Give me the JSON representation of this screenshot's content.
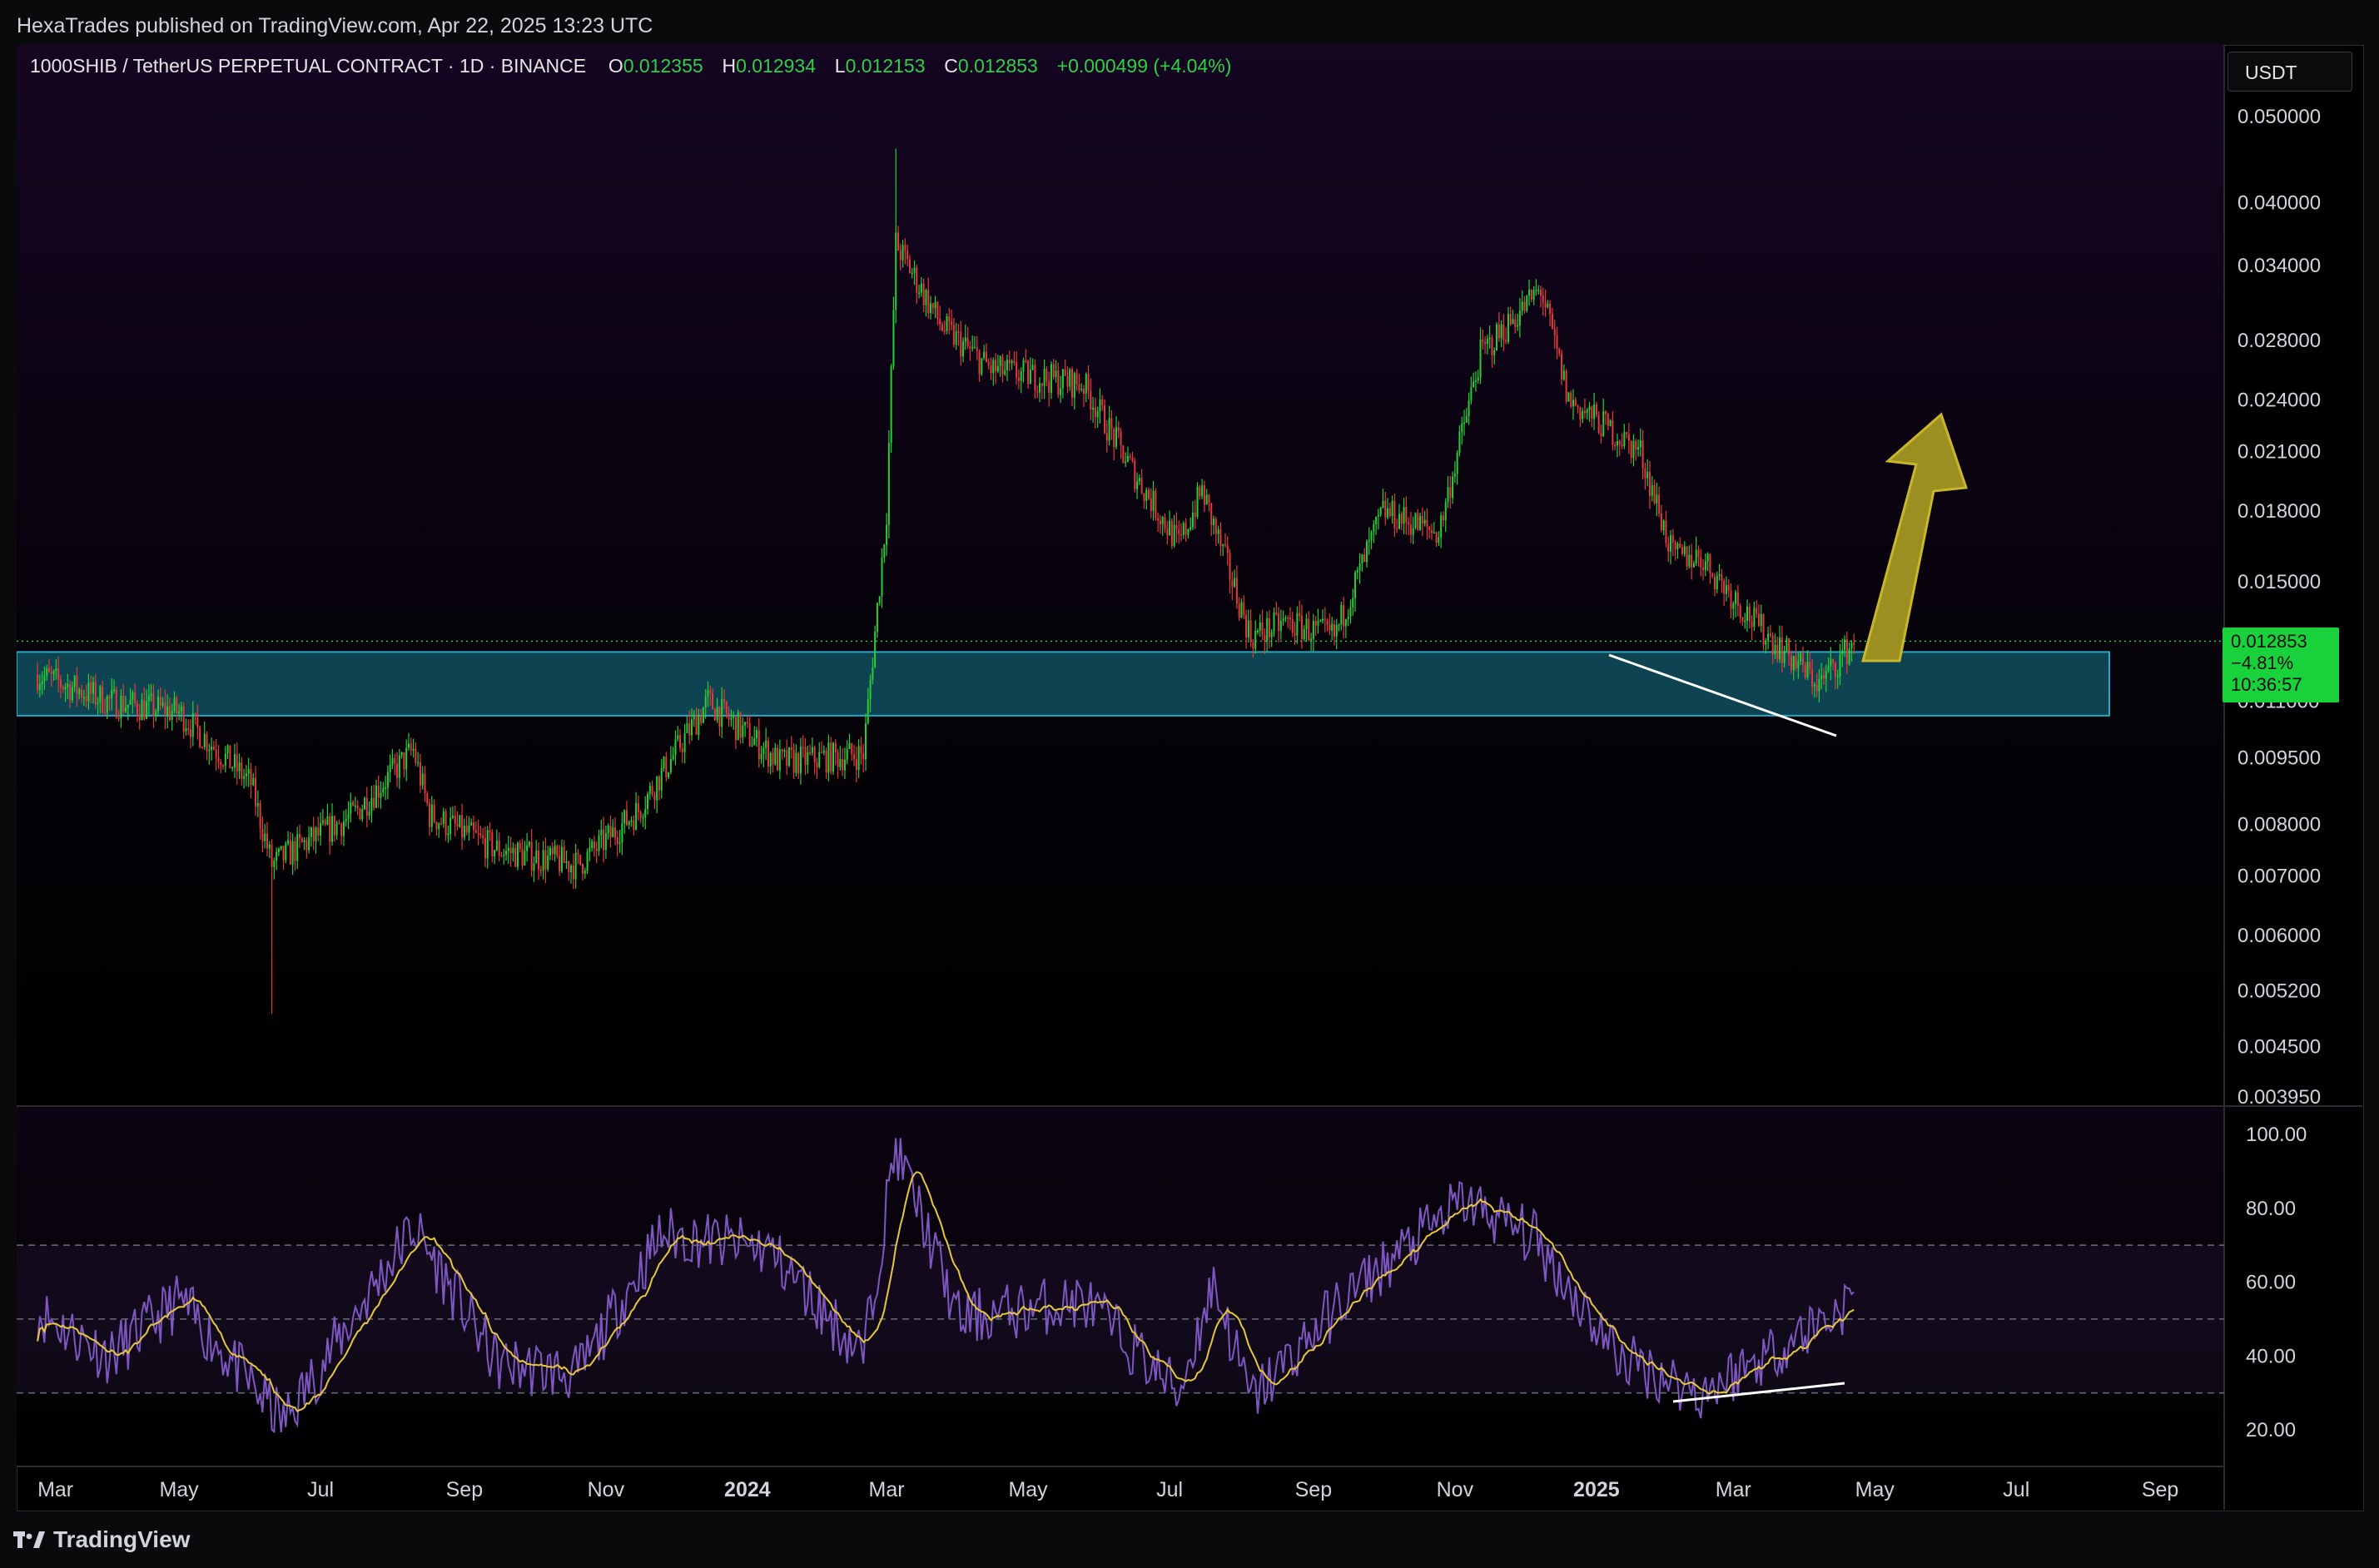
{
  "publisher": "HexaTrades published on TradingView.com, Apr 22, 2025 13:23 UTC",
  "footer_logo": "TradingView",
  "legend": {
    "symbol": "1000SHIB / TetherUS PERPETUAL CONTRACT · 1D · BINANCE",
    "o_label": "O",
    "o": "0.012355",
    "h_label": "H",
    "h": "0.012934",
    "l_label": "L",
    "l": "0.012153",
    "c_label": "C",
    "c": "0.012853",
    "change": "+0.000499 (+4.04%)"
  },
  "currency_button": "USDT",
  "last_price_tag": {
    "price": "0.012853",
    "change": "−4.81%",
    "countdown": "10:36:57"
  },
  "colors": {
    "background": "#000000",
    "up_candle": "#26d034",
    "down_candle": "#e23b3b",
    "support_zone": "#0f4a5a",
    "support_border": "#2aa6c4",
    "arrow": "#9c8f22",
    "rsi_line": "#7e57c2",
    "rsi_ma": "#e8c83a",
    "trendline": "#ffffff"
  },
  "chart_data": [
    {
      "type": "candlestick",
      "scale": "log",
      "ylim": [
        0.00395,
        0.05
      ],
      "y_ticks": [
        "0.050000",
        "0.040000",
        "0.034000",
        "0.028000",
        "0.024000",
        "0.021000",
        "0.018000",
        "0.015000",
        "0.011000",
        "0.009500",
        "0.008000",
        "0.007000",
        "0.006000",
        "0.005200",
        "0.004500",
        "0.003950"
      ],
      "x_ticks": [
        "Mar",
        "May",
        "Jul",
        "Sep",
        "Nov",
        "2024",
        "Mar",
        "May",
        "Jul",
        "Sep",
        "Nov",
        "2025",
        "Mar",
        "May",
        "Jul",
        "Sep"
      ],
      "price_path": {
        "dates": [
          "2023-03-01",
          "2023-04-01",
          "2023-05-01",
          "2023-06-01",
          "2023-06-10",
          "2023-06-20",
          "2023-07-15",
          "2023-08-10",
          "2023-08-17",
          "2023-09-15",
          "2023-10-20",
          "2023-11-15",
          "2023-12-15",
          "2024-01-15",
          "2024-02-20",
          "2024-03-01",
          "2024-03-05",
          "2024-03-25",
          "2024-04-15",
          "2024-05-25",
          "2024-06-15",
          "2024-07-05",
          "2024-07-15",
          "2024-08-05",
          "2024-08-20",
          "2024-09-10",
          "2024-10-01",
          "2024-10-25",
          "2024-11-12",
          "2024-12-08",
          "2024-12-20",
          "2025-01-20",
          "2025-02-03",
          "2025-02-15",
          "2025-03-10",
          "2025-04-07",
          "2025-04-22"
        ],
        "close": [
          0.0118,
          0.011,
          0.0107,
          0.0089,
          0.0072,
          0.0075,
          0.0082,
          0.0097,
          0.0082,
          0.0075,
          0.0072,
          0.0083,
          0.011,
          0.0094,
          0.0096,
          0.018,
          0.036,
          0.029,
          0.026,
          0.025,
          0.02,
          0.0165,
          0.019,
          0.013,
          0.0135,
          0.013,
          0.018,
          0.017,
          0.027,
          0.032,
          0.024,
          0.021,
          0.016,
          0.016,
          0.0135,
          0.0115,
          0.01285
        ]
      },
      "extremes": {
        "high": 0.046,
        "high_date": "2024-03-05",
        "low": 0.0049,
        "low_date": "2023-06-10"
      },
      "last_close": 0.012853,
      "support_zone": [
        0.0106,
        0.0125
      ],
      "annotations": [
        "support zone",
        "descending trendline at lows",
        "upward arrow projection"
      ]
    },
    {
      "type": "line",
      "name": "RSI",
      "ylim": [
        14,
        104
      ],
      "y_ticks": [
        "100.00",
        "80.00",
        "60.00",
        "40.00",
        "20.00"
      ],
      "bands": [
        30,
        50,
        70
      ],
      "rsi_path": {
        "dates": [
          "2023-03-01",
          "2023-04-01",
          "2023-05-01",
          "2023-06-15",
          "2023-08-10",
          "2023-09-15",
          "2023-10-20",
          "2023-11-25",
          "2024-01-10",
          "2024-02-20",
          "2024-03-05",
          "2024-04-01",
          "2024-05-25",
          "2024-07-05",
          "2024-07-20",
          "2024-08-05",
          "2024-09-15",
          "2024-11-05",
          "2024-12-05",
          "2025-01-10",
          "2025-02-15",
          "2025-03-20",
          "2025-04-22"
        ],
        "value": [
          52,
          40,
          55,
          22,
          75,
          38,
          35,
          73,
          69,
          40,
          97,
          50,
          55,
          30,
          60,
          28,
          56,
          82,
          72,
          40,
          30,
          42,
          55
        ]
      },
      "annotations": [
        "rising trendline at RSI lows (bullish divergence)"
      ]
    }
  ]
}
